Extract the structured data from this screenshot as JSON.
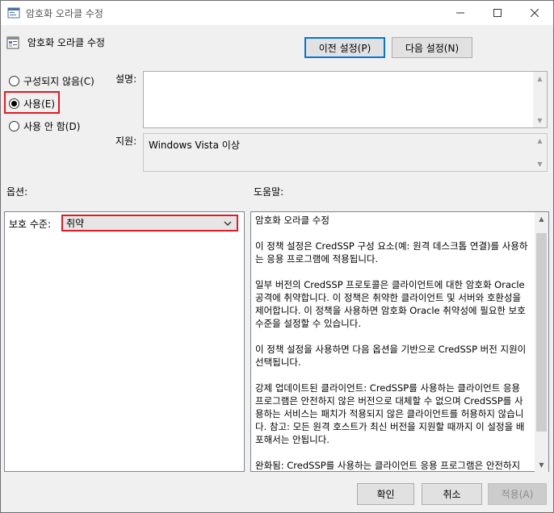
{
  "window": {
    "title": "암호화 오라클 수정",
    "header_title": "암호화 오라클 수정",
    "icons": {
      "app": "policy-window-icon",
      "header": "policy-setting-icon"
    }
  },
  "nav": {
    "prev_label": "이전 설정(P)",
    "next_label": "다음 설정(N)"
  },
  "state_options": [
    {
      "label": "구성되지 않음(C)",
      "checked": false
    },
    {
      "label": "사용(E)",
      "checked": true
    },
    {
      "label": "사용 안 함(D)",
      "checked": false
    }
  ],
  "comment": {
    "label": "설명:",
    "value": ""
  },
  "supported": {
    "label": "지원:",
    "value": "Windows Vista 이상"
  },
  "options": {
    "label": "옵션:",
    "protection_label": "보호 수준:",
    "protection_value": "취약"
  },
  "help": {
    "label": "도움말:",
    "title": "암호화 오라클 수정",
    "paragraphs": [
      "이 정책 설정은 CredSSP 구성 요소(예: 원격 데스크톱 연결)를 사용하는 응용 프로그램에 적용됩니다.",
      "일부 버전의 CredSSP 프로토콜은 클라이언트에 대한 암호화 Oracle 공격에 취약합니다.  이 정책은 취약한 클라이언트 및 서버와 호환성을 제어합니다.  이 정책을 사용하면 암호화 Oracle 취약성에 필요한 보호 수준을 설정할 수 있습니다.",
      "이 정책 설정을 사용하면 다음 옵션을 기반으로 CredSSP 버전 지원이 선택됩니다.",
      "강제 업데이트된 클라이언트: CredSSP를 사용하는 클라이언트 응용 프로그램은 안전하지 않은 버전으로 대체할 수 없으며 CredSSP를 사용하는 서비스는 패치가 적용되지 않은 클라이언트를 허용하지 않습니다. 참고: 모든 원격 호스트가 최신 버전을 지원할 때까지 이 설정을 배포해서는 안됩니다.",
      "완화됨: CredSSP를 사용하는 클라이언트 응용 프로그램은 안전하지 않은 버전으로 대체할 수 없지만 CredSSP를 사용하는 서비스는 패치가 적용되지 않은 클라이언트를 허용합니다. 패치가 적"
    ]
  },
  "footer": {
    "ok_label": "확인",
    "cancel_label": "취소",
    "apply_label": "적용(A)"
  },
  "colors": {
    "highlight": "#e01b24",
    "focus": "#0078d7"
  }
}
